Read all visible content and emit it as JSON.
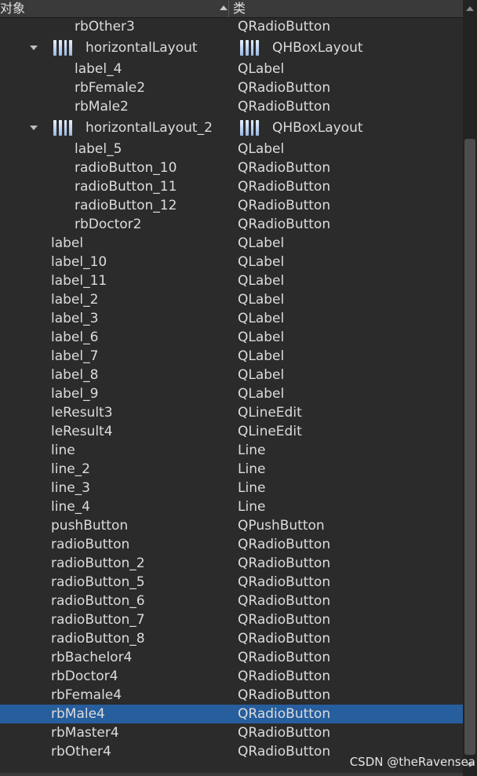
{
  "header": {
    "col_object": "对象",
    "col_class": "类"
  },
  "rows": [
    {
      "name": "rbOther3",
      "cls": "QRadioButton"
    },
    {
      "name": "horizontalLayout",
      "cls": "QHBoxLayout",
      "expandable": true,
      "icon": "horizontal-layout-icon"
    },
    {
      "name": "label_4",
      "cls": "QLabel"
    },
    {
      "name": "rbFemale2",
      "cls": "QRadioButton"
    },
    {
      "name": "rbMale2",
      "cls": "QRadioButton"
    },
    {
      "name": "horizontalLayout_2",
      "cls": "QHBoxLayout",
      "expandable": true,
      "icon": "horizontal-layout-icon"
    },
    {
      "name": "label_5",
      "cls": "QLabel"
    },
    {
      "name": "radioButton_10",
      "cls": "QRadioButton"
    },
    {
      "name": "radioButton_11",
      "cls": "QRadioButton"
    },
    {
      "name": "radioButton_12",
      "cls": "QRadioButton"
    },
    {
      "name": "rbDoctor2",
      "cls": "QRadioButton"
    },
    {
      "name": "label",
      "cls": "QLabel"
    },
    {
      "name": "label_10",
      "cls": "QLabel"
    },
    {
      "name": "label_11",
      "cls": "QLabel"
    },
    {
      "name": "label_2",
      "cls": "QLabel"
    },
    {
      "name": "label_3",
      "cls": "QLabel"
    },
    {
      "name": "label_6",
      "cls": "QLabel"
    },
    {
      "name": "label_7",
      "cls": "QLabel"
    },
    {
      "name": "label_8",
      "cls": "QLabel"
    },
    {
      "name": "label_9",
      "cls": "QLabel"
    },
    {
      "name": "leResult3",
      "cls": "QLineEdit"
    },
    {
      "name": "leResult4",
      "cls": "QLineEdit"
    },
    {
      "name": "line",
      "cls": "Line"
    },
    {
      "name": "line_2",
      "cls": "Line"
    },
    {
      "name": "line_3",
      "cls": "Line"
    },
    {
      "name": "line_4",
      "cls": "Line"
    },
    {
      "name": "pushButton",
      "cls": "QPushButton"
    },
    {
      "name": "radioButton",
      "cls": "QRadioButton"
    },
    {
      "name": "radioButton_2",
      "cls": "QRadioButton"
    },
    {
      "name": "radioButton_5",
      "cls": "QRadioButton"
    },
    {
      "name": "radioButton_6",
      "cls": "QRadioButton"
    },
    {
      "name": "radioButton_7",
      "cls": "QRadioButton"
    },
    {
      "name": "radioButton_8",
      "cls": "QRadioButton"
    },
    {
      "name": "rbBachelor4",
      "cls": "QRadioButton"
    },
    {
      "name": "rbDoctor4",
      "cls": "QRadioButton"
    },
    {
      "name": "rbFemale4",
      "cls": "QRadioButton"
    },
    {
      "name": "rbMale4",
      "cls": "QRadioButton",
      "selected": true
    },
    {
      "name": "rbMaster4",
      "cls": "QRadioButton"
    },
    {
      "name": "rbOther4",
      "cls": "QRadioButton"
    }
  ],
  "watermark": "CSDN @theRavensea",
  "colors": {
    "background": "#2b2b2b",
    "header": "#3a3a3a",
    "selection": "#265e9e",
    "text": "#dcdcdc"
  }
}
